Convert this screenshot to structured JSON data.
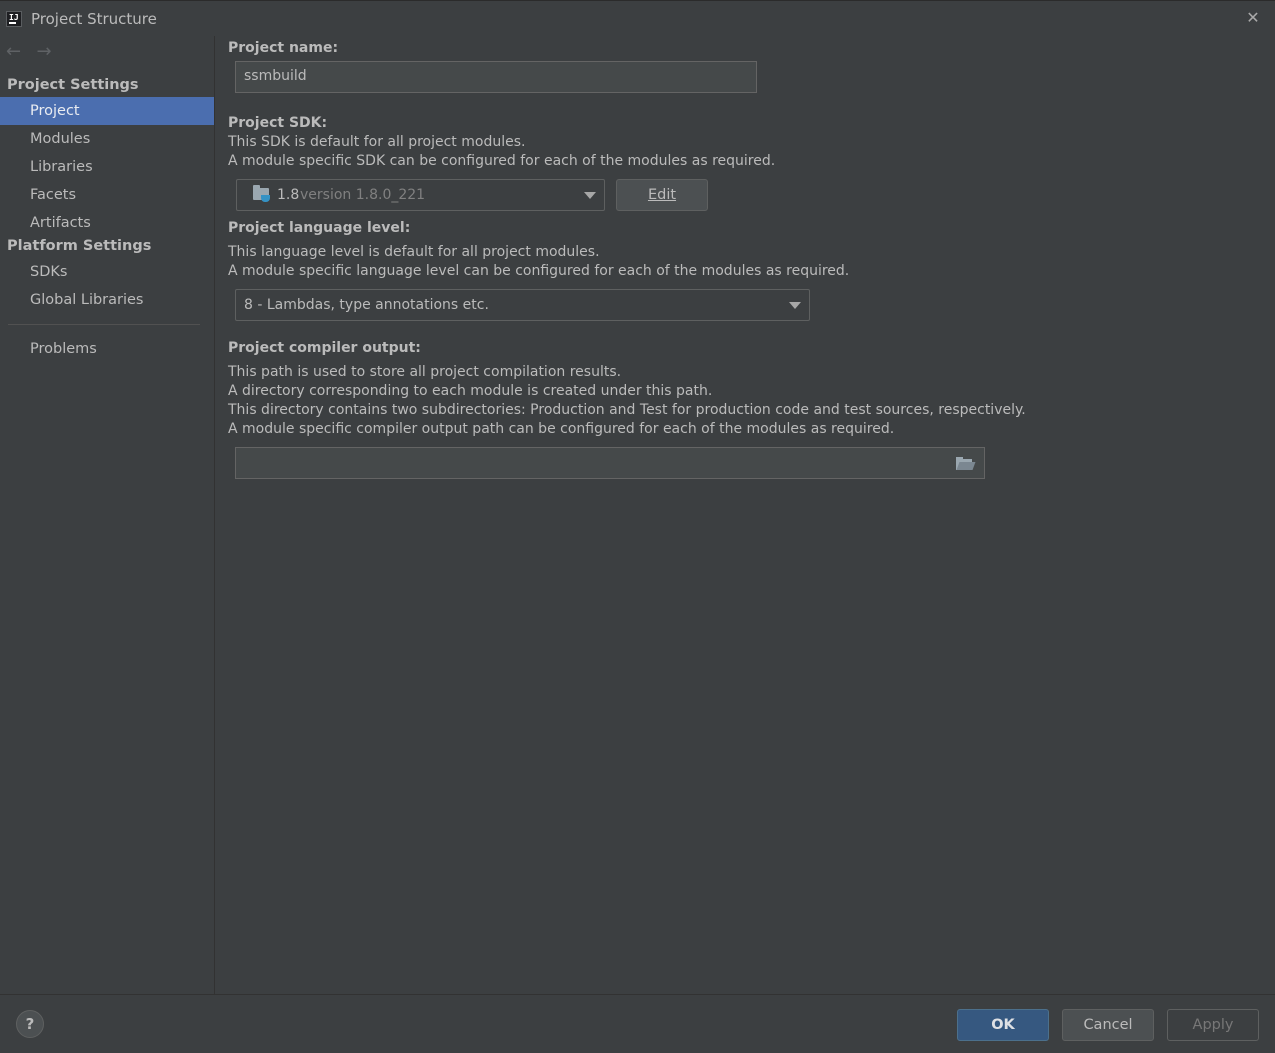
{
  "window": {
    "title": "Project Structure",
    "app_icon_text": "IJ"
  },
  "sidebar": {
    "back_arrow": "←",
    "forward_arrow": "→",
    "project_settings_header": "Project Settings",
    "project_settings_items": [
      "Project",
      "Modules",
      "Libraries",
      "Facets",
      "Artifacts"
    ],
    "selected_item": "Project",
    "platform_settings_header": "Platform Settings",
    "platform_settings_items": [
      "SDKs",
      "Global Libraries"
    ],
    "problems_item": "Problems"
  },
  "project_name": {
    "label": "Project name:",
    "value": "ssmbuild"
  },
  "project_sdk": {
    "label": "Project SDK:",
    "desc_1": "This SDK is default for all project modules.",
    "desc_2": "A module specific SDK can be configured for each of the modules as required.",
    "selected_name": "1.8",
    "selected_version": "version 1.8.0_221",
    "edit_button_label": "Edit"
  },
  "language_level": {
    "label": "Project language level:",
    "desc_1": "This language level is default for all project modules.",
    "desc_2": "A module specific language level can be configured for each of the modules as required.",
    "selected": "8 - Lambdas, type annotations etc."
  },
  "compiler_output": {
    "label": "Project compiler output:",
    "desc_1": "This path is used to store all project compilation results.",
    "desc_2": "A directory corresponding to each module is created under this path.",
    "desc_3": "This directory contains two subdirectories: Production and Test for production code and test sources, respectively.",
    "desc_4": "A module specific compiler output path can be configured for each of the modules as required.",
    "value": ""
  },
  "footer": {
    "help_label": "?",
    "ok_label": "OK",
    "cancel_label": "Cancel",
    "apply_label": "Apply"
  },
  "colors": {
    "background": "#3c3f41",
    "selection": "#4b6eaf",
    "primary_button": "#365880",
    "text": "#bbbbbb"
  }
}
